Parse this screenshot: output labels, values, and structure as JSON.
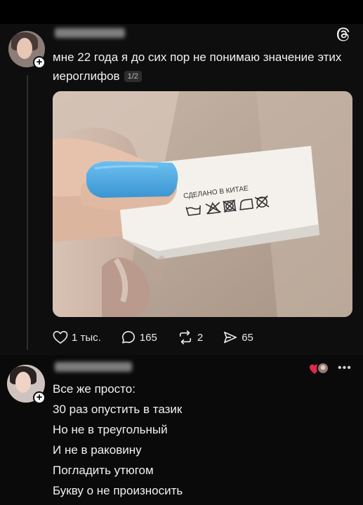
{
  "post": {
    "text": "мне 22 года я до сих пор не понимаю значение этих иероглифов",
    "page_indicator": "1/2",
    "photo": {
      "label_text": "СДЕЛАНО В КИТАЕ"
    },
    "actions": {
      "likes": "1 тыс.",
      "comments": "165",
      "reposts": "2",
      "shares": "65"
    }
  },
  "reply": {
    "lines": [
      "Все же просто:",
      "30 раз опустить в тазик",
      "Но не в треугольный",
      "И не в раковину",
      "Погладить утюгом",
      "Букву о не произносить"
    ],
    "more": "•••"
  },
  "colors": {
    "background": "#000000",
    "text": "#f1f1f1",
    "nail_blue": "#4ea9e1",
    "reaction_red": "#e0284f"
  },
  "icons": [
    "threads-icon",
    "heart-icon",
    "comment-icon",
    "repost-icon",
    "share-icon",
    "more-icon",
    "plus-icon"
  ]
}
